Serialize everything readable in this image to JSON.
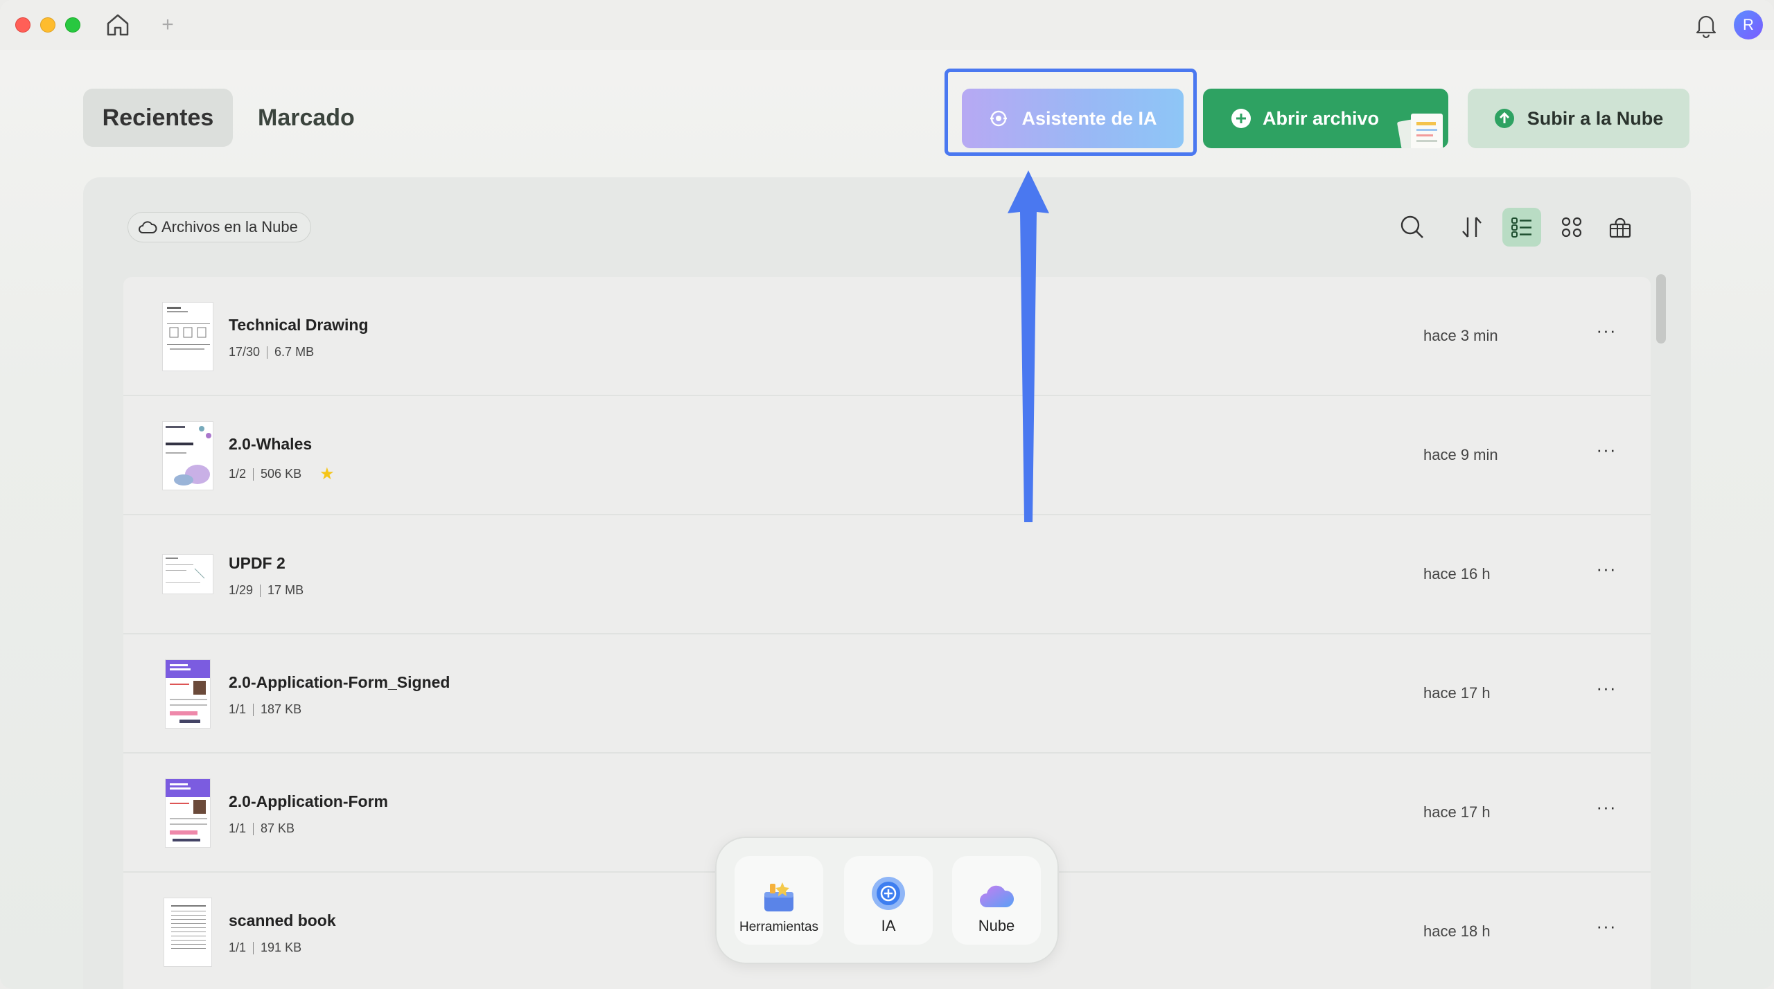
{
  "tabs": {
    "recent": "Recientes",
    "marked": "Marcado"
  },
  "actions": {
    "ai_assistant": "Asistente de IA",
    "open_file": "Abrir archivo",
    "upload_cloud": "Subir a la Nube"
  },
  "toolbar": {
    "cloud_files": "Archivos en la Nube"
  },
  "user": {
    "initial": "R"
  },
  "files": [
    {
      "name": "Technical Drawing",
      "pages": "17/30",
      "size": "6.7 MB",
      "time": "hace 3 min",
      "starred": false
    },
    {
      "name": "2.0-Whales",
      "pages": "1/2",
      "size": "506 KB",
      "time": "hace 9 min",
      "starred": true
    },
    {
      "name": "UPDF 2",
      "pages": "1/29",
      "size": "17 MB",
      "time": "hace 16 h",
      "starred": false
    },
    {
      "name": "2.0-Application-Form_Signed",
      "pages": "1/1",
      "size": "187 KB",
      "time": "hace 17 h",
      "starred": false
    },
    {
      "name": "2.0-Application-Form",
      "pages": "1/1",
      "size": "87 KB",
      "time": "hace 17 h",
      "starred": false
    },
    {
      "name": "scanned book",
      "pages": "1/1",
      "size": "191 KB",
      "time": "hace 18 h",
      "starred": false
    }
  ],
  "dock": {
    "tools": "Herramientas",
    "ai": "IA",
    "cloud": "Nube"
  },
  "colors": {
    "accent_green": "#2ea262",
    "highlight_blue": "#4a78f0"
  }
}
